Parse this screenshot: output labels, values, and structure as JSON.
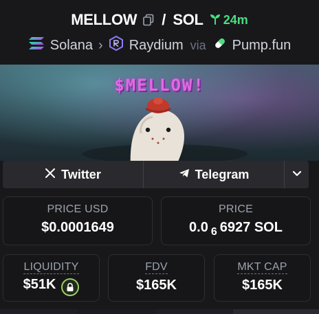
{
  "header": {
    "base_token": "MELLOW",
    "separator": "/",
    "quote_token": "SOL",
    "age": "24m",
    "chain": "Solana",
    "dex": "Raydium",
    "via": "via",
    "launchpad": "Pump.fun"
  },
  "banner": {
    "text": "$MELLOW!"
  },
  "socials": {
    "twitter": "Twitter",
    "telegram": "Telegram"
  },
  "stats": {
    "price_usd": {
      "label": "PRICE USD",
      "value": "$0.0001649"
    },
    "price_sol": {
      "label": "PRICE",
      "value_prefix": "0.0",
      "subscript": "6",
      "value_suffix": "6927 SOL"
    },
    "liquidity": {
      "label": "LIQUIDITY",
      "value": "$51K"
    },
    "fdv": {
      "label": "FDV",
      "value": "$165K"
    },
    "mkt_cap": {
      "label": "MKT CAP",
      "value": "$165K"
    }
  },
  "colors": {
    "background": "#18181b",
    "accent_green": "#4ade80",
    "lock_green": "#9ccc65",
    "banner_text": "#e26ae0"
  },
  "icons": [
    "copy-icon",
    "seedling-icon",
    "solana-icon",
    "chevron-right-icon",
    "raydium-icon",
    "pill-icon",
    "x-icon",
    "telegram-icon",
    "chevron-down-icon",
    "lock-icon"
  ]
}
